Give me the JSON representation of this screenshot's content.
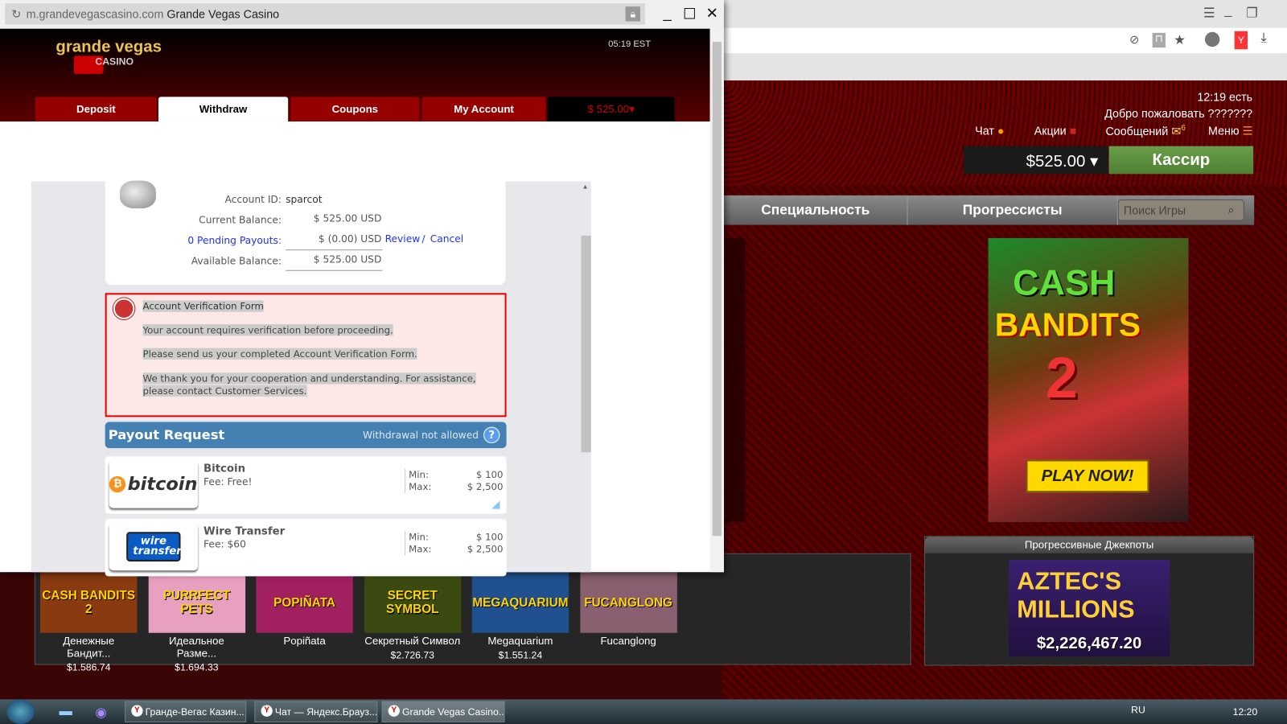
{
  "popup": {
    "url_domain": "m.grandevegascasino.com",
    "page_title": "Grande Vegas Casino",
    "logo_text": "grande vegas",
    "logo_sub": "CASINO",
    "clock": "05:19 EST",
    "tabs": [
      {
        "label": "Deposit",
        "active": false
      },
      {
        "label": "Withdraw",
        "active": true
      },
      {
        "label": "Coupons",
        "active": false
      },
      {
        "label": "My Account",
        "active": false
      }
    ],
    "balance_tab": "$ 525.00",
    "account": {
      "account_id_label": "Account ID:",
      "account_id": "sparcot",
      "current_balance_label": "Current Balance:",
      "current_balance": "$ 525.00 USD",
      "pending_label": "0 Pending Payouts",
      "pending_value": "$ (0.00) USD",
      "review": "Review",
      "separator": "/",
      "cancel": "Cancel",
      "available_label": "Available Balance:",
      "available_balance": "$ 525.00 USD"
    },
    "verification": {
      "title": "Account Verification Form",
      "line1": "Your account requires verification before proceeding.",
      "line2": "Please send us your completed Account Verification Form.",
      "line3a": "We thank you for your cooperation and understanding. For assistance,",
      "line3b": "please contact Customer Services."
    },
    "payout": {
      "title": "Payout Request",
      "status": "Withdrawal not allowed",
      "help": "?",
      "methods": [
        {
          "name": "Bitcoin",
          "logo": "bitcoin",
          "fee": "Fee: Free!",
          "min_label": "Min:",
          "min": "$ 100",
          "max_label": "Max:",
          "max": "$ 2,500"
        },
        {
          "name": "Wire Transfer",
          "logo": "wire transfer",
          "fee": "Fee: $60",
          "min_label": "Min:",
          "min": "$ 100",
          "max_label": "Max:",
          "max": "$ 2,500"
        }
      ]
    }
  },
  "site": {
    "time": "12:19 есть",
    "welcome": "Добро пожаловать ???????",
    "chat": "Чат",
    "promos": "Акции",
    "messages": "Сообщений",
    "messages_badge": "6",
    "menu": "Меню",
    "balance": "$525.00",
    "cashier": "Кассир",
    "nav": [
      "Специальность",
      "Прогрессисты"
    ],
    "search_placeholder": "Поиск Игры",
    "banner": {
      "line1": "CASH",
      "line2": "BANDITS",
      "line3": "2",
      "cta": "PLAY NOW!"
    },
    "games": [
      {
        "name": "Денежные Бандит...",
        "thumb": "CASH BANDITS 2",
        "jackpot": "$1.586.74",
        "color": "#8a3a10"
      },
      {
        "name": "Идеальное Разме...",
        "thumb": "PURRFECT PETS",
        "jackpot": "$1.694.33",
        "color": "#e8a0c0"
      },
      {
        "name": "Popiñata",
        "thumb": "POPIÑATA",
        "jackpot": "",
        "color": "#a02060"
      },
      {
        "name": "Секретный Символ",
        "thumb": "SECRET SYMBOL",
        "jackpot": "$2.726.73",
        "color": "#3a4a10"
      },
      {
        "name": "Megaquarium",
        "thumb": "MEGAQUARIUM",
        "jackpot": "$1.551.24",
        "color": "#205090"
      },
      {
        "name": "Fucanglong",
        "thumb": "FUCANGLONG",
        "jackpot": "",
        "color": "#8a6070"
      }
    ],
    "jackpots_title": "Прогрессивные Джекпоты",
    "jackpot_game": "AZTEC'S MILLIONS",
    "jackpot_amount": "$2,226,467.20"
  },
  "taskbar": {
    "items": [
      "Гранде-Вегас Казин...",
      "Чат — Яндекс.Брауз...",
      "Grande Vegas Casino..."
    ],
    "lang": "RU",
    "time": "12:20"
  }
}
